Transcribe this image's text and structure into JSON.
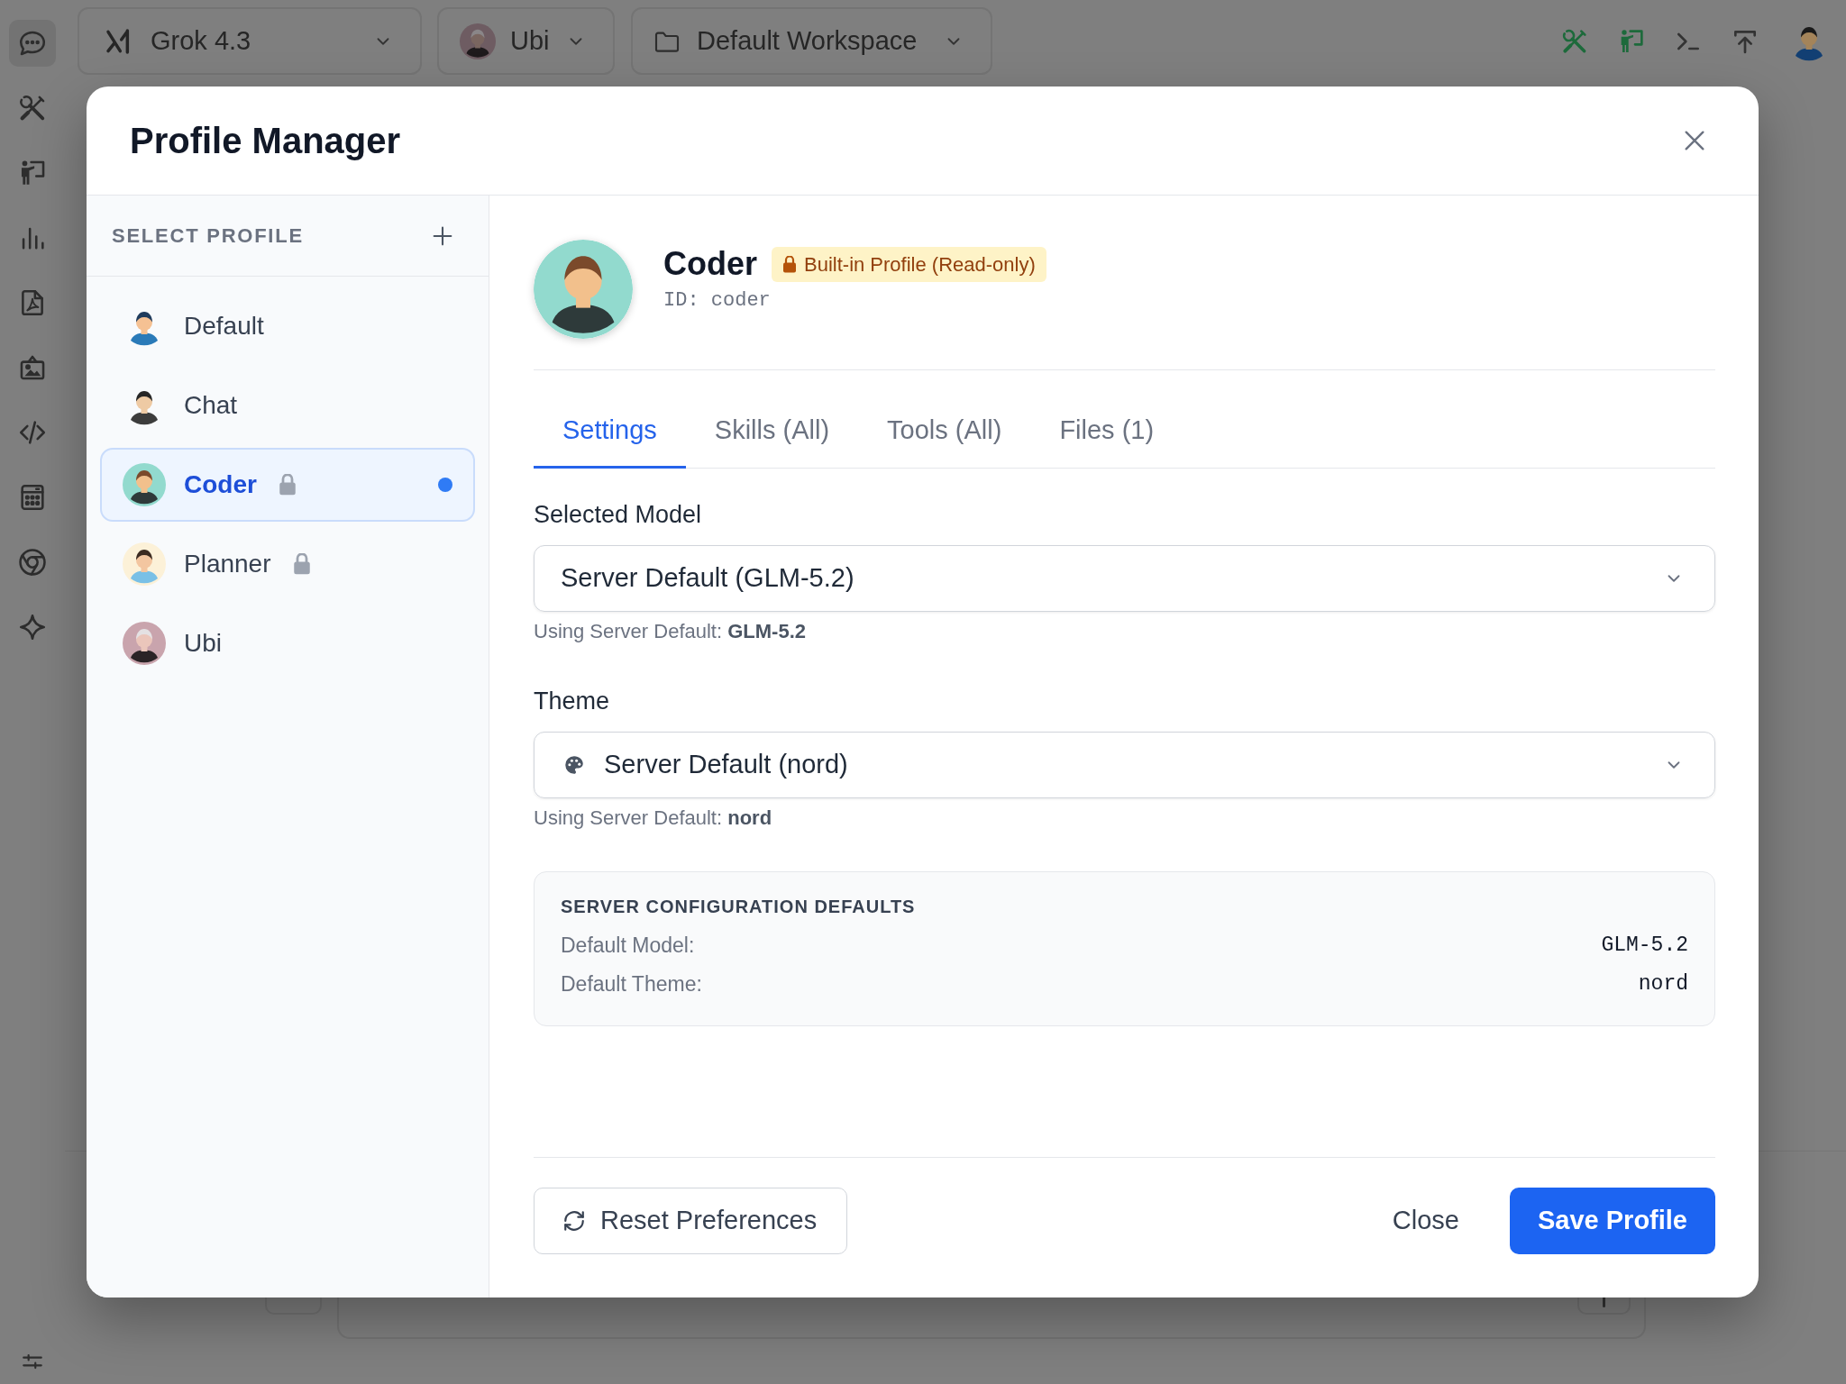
{
  "rail": {
    "items": [
      {
        "selected": true
      },
      {
        "selected": false
      },
      {
        "selected": false
      },
      {
        "selected": false
      },
      {
        "selected": false
      },
      {
        "selected": false
      },
      {
        "selected": false
      },
      {
        "selected": false
      },
      {
        "selected": false
      },
      {
        "selected": false
      }
    ]
  },
  "top_bar": {
    "model": "Grok 4.3",
    "profile": "Ubi",
    "workspace": "Default Workspace",
    "tools": [
      {
        "on": true
      },
      {
        "on": true
      },
      {
        "on": false
      },
      {
        "on": false
      }
    ]
  },
  "dialog": {
    "title": "Profile Manager",
    "sidebar": {
      "heading": "SELECT PROFILE",
      "profiles": [
        {
          "name": "Default",
          "selected": false,
          "locked": false,
          "active": false
        },
        {
          "name": "Chat",
          "selected": false,
          "locked": false,
          "active": false
        },
        {
          "name": "Coder",
          "selected": true,
          "locked": true,
          "active": true
        },
        {
          "name": "Planner",
          "selected": false,
          "locked": true,
          "active": false
        },
        {
          "name": "Ubi",
          "selected": false,
          "locked": false,
          "active": false
        }
      ]
    },
    "profile": {
      "name": "Coder",
      "badge": "Built-in Profile (Read-only)",
      "id": "ID: coder"
    },
    "tabs": [
      {
        "label": "Settings",
        "selected": true
      },
      {
        "label": "Skills (All)",
        "selected": false
      },
      {
        "label": "Tools (All)",
        "selected": false
      },
      {
        "label": "Files (1)",
        "selected": false
      }
    ],
    "settings": {
      "fields": [
        {
          "kind": "model",
          "label": "Selected Model",
          "value": "Server Default (GLM-5.2)",
          "helper": "Using Server Default: **GLM-5.2**"
        },
        {
          "kind": "theme",
          "label": "Theme",
          "value": "Server Default (nord)",
          "helper": "Using Server Default: **nord**"
        }
      ]
    },
    "server_defaults": {
      "title": "SERVER CONFIGURATION DEFAULTS",
      "rows": [
        {
          "label": "Default Model:",
          "value": "GLM-5.2"
        },
        {
          "label": "Default Theme:",
          "value": "nord"
        }
      ]
    },
    "footer": {
      "reset": "Reset Preferences",
      "close": "Close",
      "save": "Save Profile"
    }
  }
}
